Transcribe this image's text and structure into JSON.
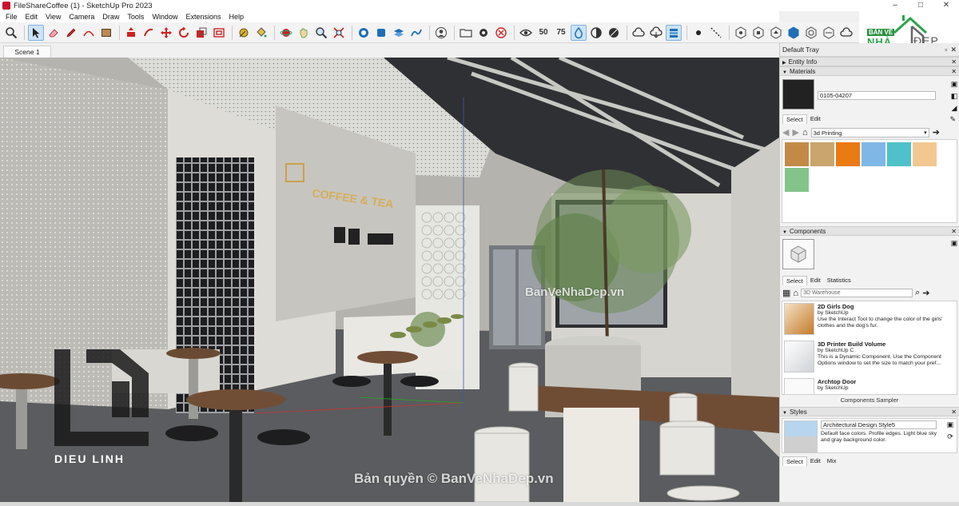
{
  "window": {
    "title": "FileShareCoffee (1) - SketchUp Pro 2023",
    "controls": [
      "–",
      "□",
      "✕"
    ]
  },
  "menu": [
    "File",
    "Edit",
    "View",
    "Camera",
    "Draw",
    "Tools",
    "Window",
    "Extensions",
    "Help"
  ],
  "toolbar": {
    "counters": [
      "50",
      "75"
    ]
  },
  "logo": {
    "top": "BẢN VẼ",
    "nha": "NHÀ",
    "dep": "ĐẸP"
  },
  "scene": {
    "tab": "Scene 1"
  },
  "viewport": {
    "sign_text": "COFFEE & TEA",
    "brand": "DIEU LINH",
    "watermark_center": "BanVeNhaDep.vn",
    "watermark_bottom": "Bản quyền © BanVeNhaDep.vn"
  },
  "tray": {
    "title": "Default Tray",
    "entity_info": "Entity Info",
    "materials": {
      "header": "Materials",
      "name": "0105-04207",
      "tabs": [
        "Select",
        "Edit"
      ],
      "library": "3d Printing",
      "swatch_colors": [
        "#c38a45",
        "#caa56e",
        "#ea7a12",
        "#7fb8e6",
        "#4fc1c8",
        "#f3c890",
        "#82c48a"
      ]
    },
    "components": {
      "header": "Components",
      "tabs": [
        "Select",
        "Edit",
        "Statistics"
      ],
      "search_placeholder": "3D Warehouse",
      "items": [
        {
          "title": "2D Girls Dog",
          "by": "by SketchUp",
          "desc": "Use the Interact Tool to change the color of the girls' clothes and the dog's fur."
        },
        {
          "title": "3D Printer Build Volume",
          "by": "by SketchUp C",
          "desc": "This is a Dynamic Component. Use the Component Options window to set the size to match your pref..."
        },
        {
          "title": "Archtop Door",
          "by": "by SketchUp",
          "desc": ""
        }
      ],
      "footer": "Components Sampler"
    },
    "styles": {
      "header": "Styles",
      "name": "Architectural Design Style5",
      "desc": "Default face colors. Profile edges. Light blue sky and gray background color.",
      "tabs": [
        "Select",
        "Edit",
        "Mix"
      ]
    }
  }
}
